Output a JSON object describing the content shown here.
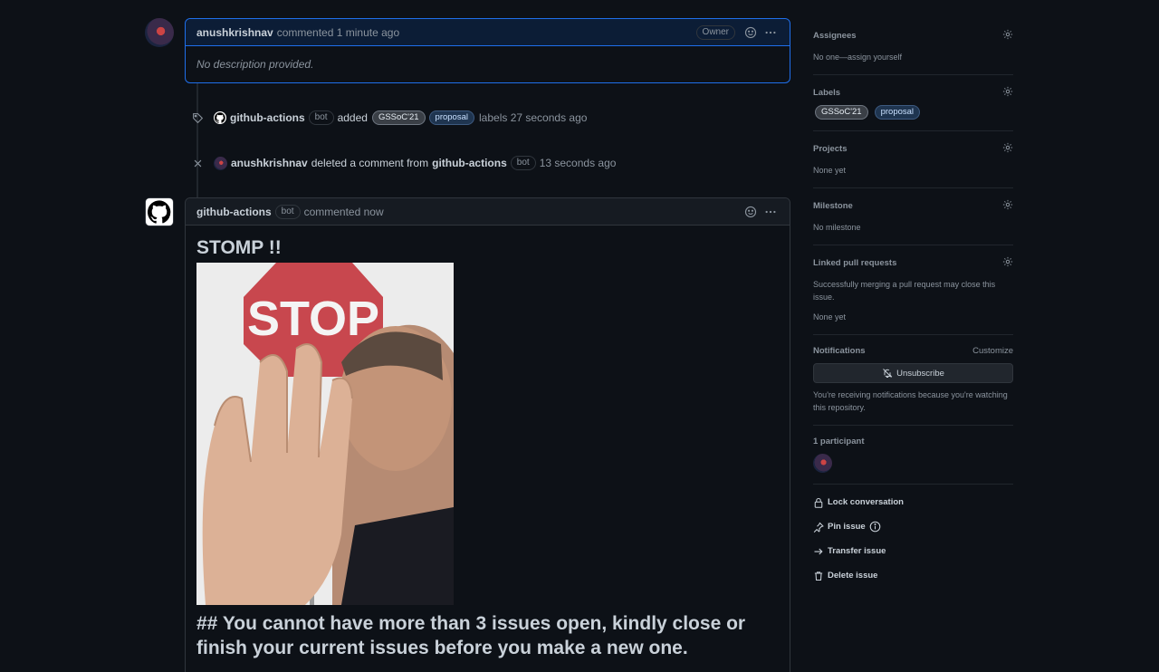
{
  "first_comment": {
    "author": "anushkrishnav",
    "action": "commented 1 minute ago",
    "owner_badge": "Owner",
    "body": "No description provided."
  },
  "label_event": {
    "actor": "github-actions",
    "bot_badge": "bot",
    "verb": "added",
    "labels": [
      "GSSoC'21",
      "proposal"
    ],
    "suffix": "labels 27 seconds ago"
  },
  "delete_event": {
    "actor": "anushkrishnav",
    "verb": "deleted a comment from",
    "target": "github-actions",
    "bot_badge": "bot",
    "time": "13 seconds ago"
  },
  "bot_comment": {
    "author": "github-actions",
    "bot_badge": "bot",
    "action": "commented now",
    "title": "STOMP !!",
    "image_text": "STOP",
    "message": "## You cannot have more than 3 issues open, kindly close or finish your current issues before you make a new one."
  },
  "sidebar": {
    "assignees": {
      "title": "Assignees",
      "text": "No one—assign yourself"
    },
    "labels": {
      "title": "Labels",
      "items": [
        "GSSoC'21",
        "proposal"
      ]
    },
    "projects": {
      "title": "Projects",
      "text": "None yet"
    },
    "milestone": {
      "title": "Milestone",
      "text": "No milestone"
    },
    "linked": {
      "title": "Linked pull requests",
      "text": "Successfully merging a pull request may close this issue.",
      "text2": "None yet"
    },
    "notifications": {
      "title": "Notifications",
      "customize": "Customize",
      "button": "Unsubscribe",
      "text": "You're receiving notifications because you're watching this repository."
    },
    "participants": {
      "title": "1 participant"
    },
    "actions": {
      "lock": "Lock conversation",
      "pin": "Pin issue",
      "transfer": "Transfer issue",
      "delete": "Delete issue"
    }
  },
  "colors": {
    "background": "#0d1117",
    "border": "#30363d",
    "accent": "#1f6feb",
    "text": "#c9d1d9",
    "muted": "#8b949e"
  }
}
